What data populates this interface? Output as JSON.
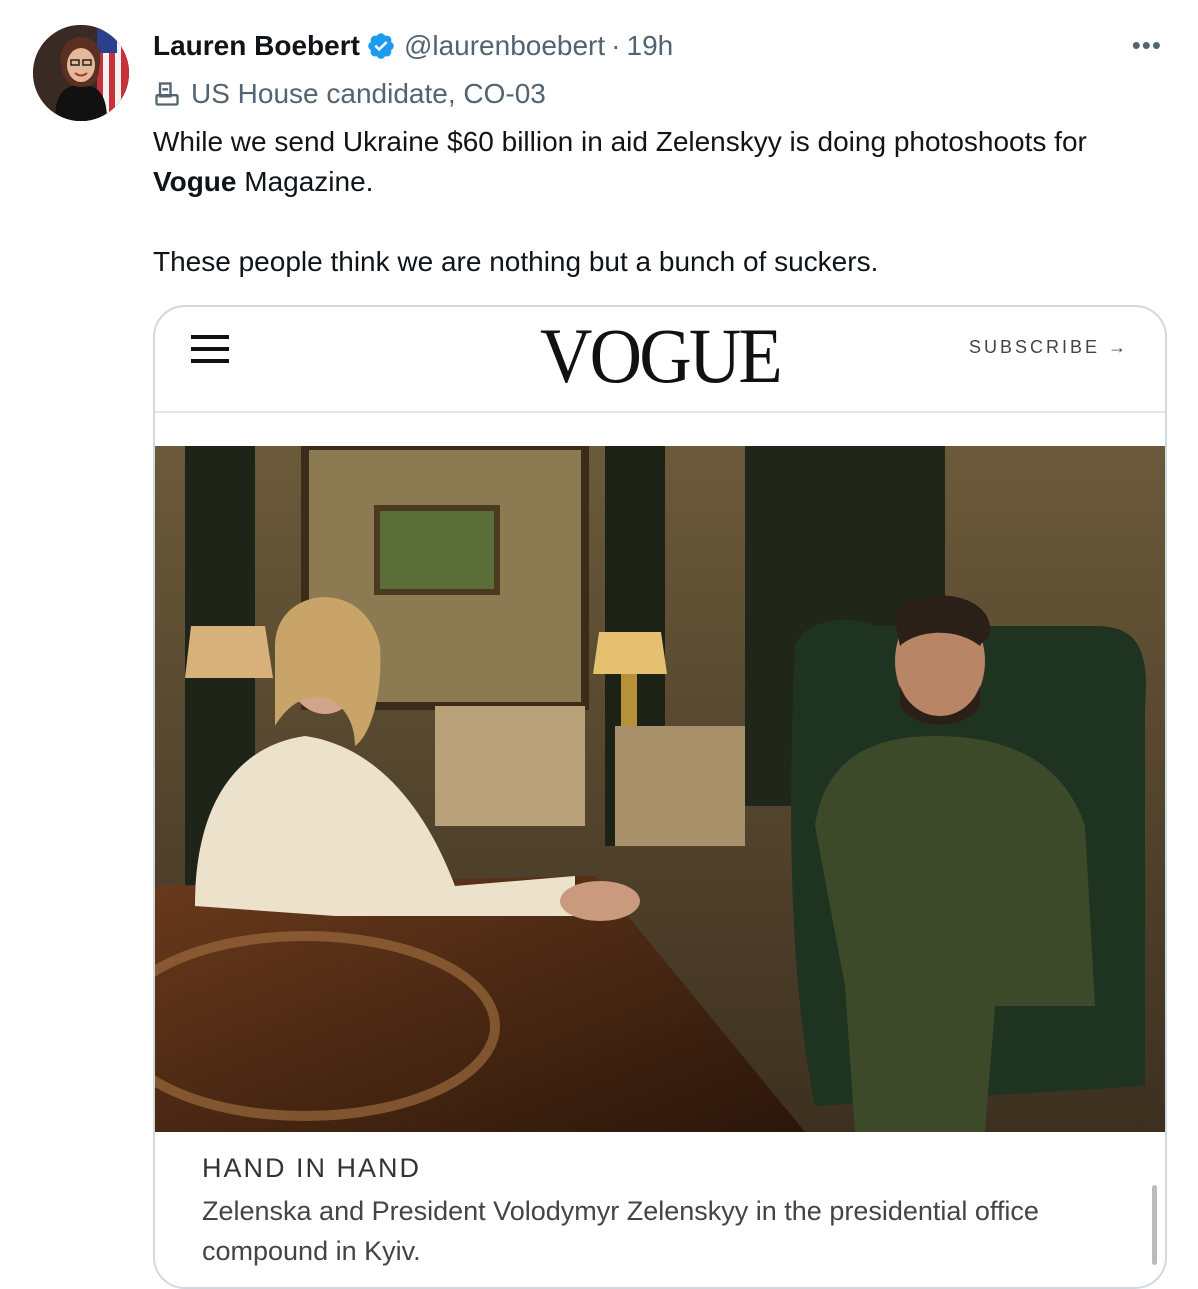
{
  "tweet": {
    "author_name": "Lauren Boebert",
    "handle": "@laurenboebert",
    "separator": "·",
    "time": "19h",
    "affiliation": "US House candidate, CO-03",
    "text_line1_prefix": "While we send Ukraine $60 billion in aid Zelenskyy is doing photoshoots for ",
    "text_bold": "Vogue",
    "text_line1_suffix": " Magazine.",
    "text_line2": "These people think we are nothing but a bunch of suckers.",
    "more_icon": "•••"
  },
  "media": {
    "logo": "VOGUE",
    "subscribe": "SUBSCRIBE →",
    "caption_title": "HAND IN HAND",
    "caption_text": "Zelenska and President Volodymyr Zelenskyy in the presidential office compound in Kyiv."
  },
  "colors": {
    "verified": "#1d9bf0",
    "secondary_text": "#536471",
    "border": "#cfd9de"
  },
  "icons": {
    "verified": "verified-badge-icon",
    "affiliation": "ballot-box-icon",
    "more": "more-options-icon",
    "menu": "hamburger-menu-icon"
  }
}
